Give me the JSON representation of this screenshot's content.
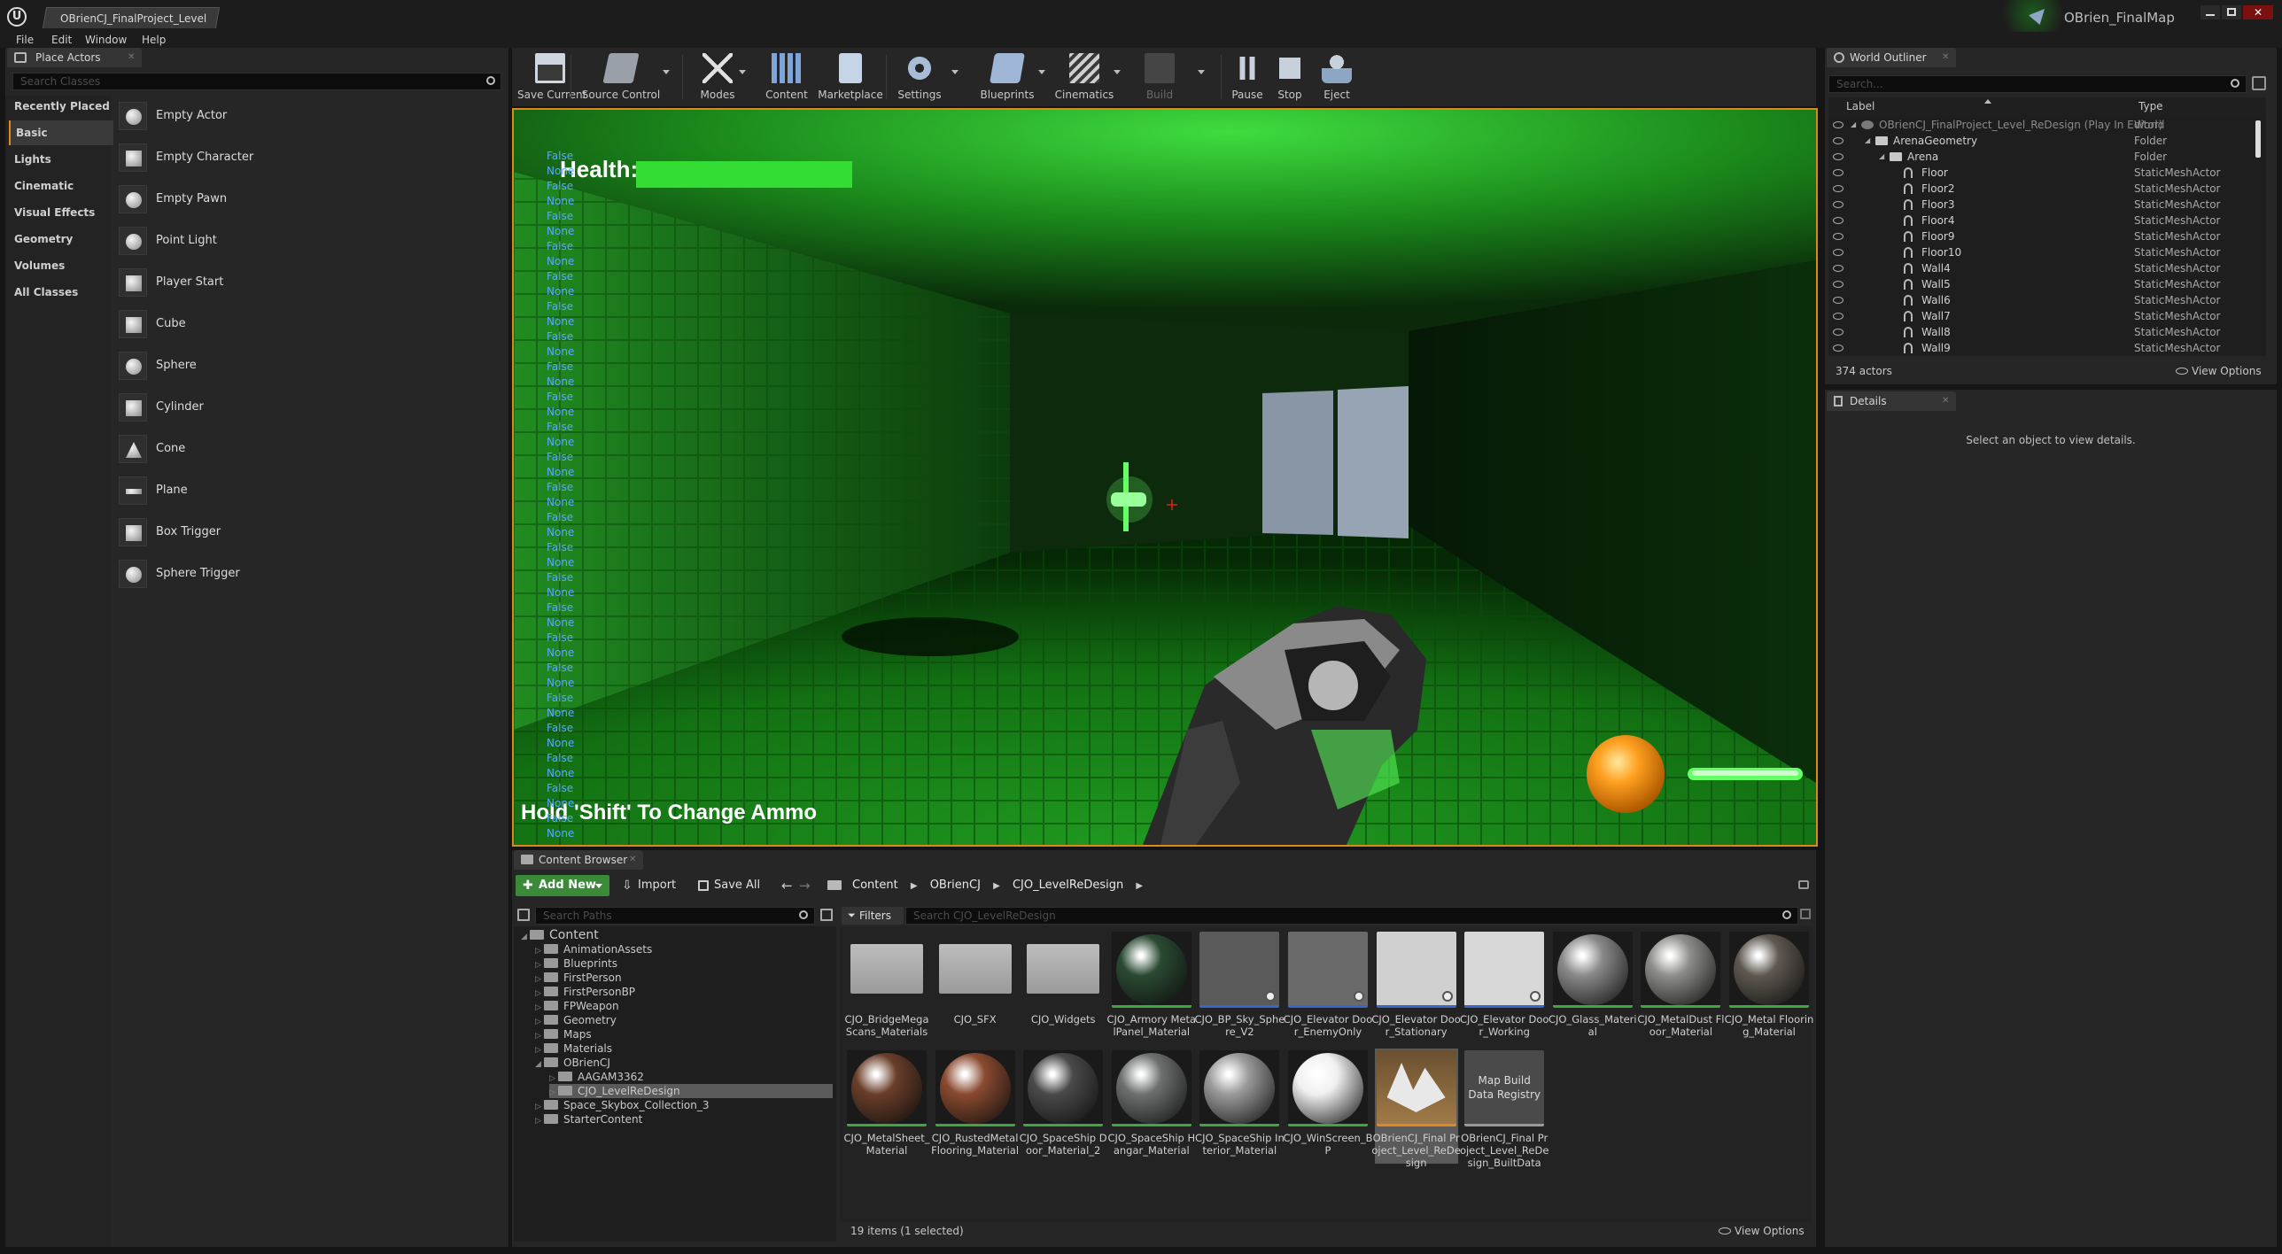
{
  "title_bar": {
    "doc_tab": "OBrienCJ_FinalProject_Level",
    "project_name": "OBrien_FinalMap",
    "window_controls": [
      "minimize",
      "maximize",
      "close"
    ]
  },
  "menu": [
    "File",
    "Edit",
    "Window",
    "Help"
  ],
  "place_actors": {
    "tab_label": "Place Actors",
    "search_placeholder": "Search Classes",
    "categories": [
      "Recently Placed",
      "Basic",
      "Lights",
      "Cinematic",
      "Visual Effects",
      "Geometry",
      "Volumes",
      "All Classes"
    ],
    "selected_category": "Basic",
    "items": [
      "Empty Actor",
      "Empty Character",
      "Empty Pawn",
      "Point Light",
      "Player Start",
      "Cube",
      "Sphere",
      "Cylinder",
      "Cone",
      "Plane",
      "Box Trigger",
      "Sphere Trigger"
    ]
  },
  "toolbar": {
    "buttons": [
      {
        "label": "Save Current",
        "icon": "save-icon"
      },
      {
        "label": "Source Control",
        "icon": "source-control-icon"
      },
      {
        "label": "Modes",
        "icon": "modes-icon"
      },
      {
        "label": "Content",
        "icon": "content-icon"
      },
      {
        "label": "Marketplace",
        "icon": "marketplace-icon"
      },
      {
        "label": "Settings",
        "icon": "settings-icon"
      },
      {
        "label": "Blueprints",
        "icon": "blueprints-icon"
      },
      {
        "label": "Cinematics",
        "icon": "cinematics-icon"
      },
      {
        "label": "Build",
        "icon": "build-icon"
      },
      {
        "label": "Pause",
        "icon": "pause-icon"
      },
      {
        "label": "Stop",
        "icon": "stop-icon"
      },
      {
        "label": "Eject",
        "icon": "eject-icon"
      }
    ]
  },
  "viewport": {
    "hud_health_label": "Health:",
    "hud_health_fraction": 1.0,
    "hud_ammo_text": "Hold 'Shift' To Change Ammo",
    "debug_lines": [
      "False",
      "None",
      "False",
      "None",
      "False",
      "None",
      "False",
      "None",
      "False",
      "None",
      "False",
      "None",
      "False",
      "None",
      "False",
      "None",
      "False",
      "None",
      "False",
      "None",
      "False",
      "None",
      "False",
      "None",
      "False",
      "None",
      "False",
      "None",
      "False",
      "None",
      "False",
      "None",
      "False",
      "None",
      "False",
      "None",
      "False",
      "None"
    ],
    "debug_lines_2": [
      "False",
      "None",
      "False",
      "None",
      "False",
      "None",
      "False",
      "None"
    ],
    "colors": {
      "hud_green": "#33dd33",
      "scene_green": "#1f8a1f",
      "ammo_orb": "#ffa020"
    }
  },
  "world_outliner": {
    "tab_label": "World Outliner",
    "search_placeholder": "Search...",
    "col_label": "Label",
    "col_type": "Type",
    "rows": [
      {
        "name": "OBrienCJ_FinalProject_Level_ReDesign (Play In Editor)",
        "type": "World",
        "depth": 0,
        "kind": "world"
      },
      {
        "name": "ArenaGeometry",
        "type": "Folder",
        "depth": 1,
        "kind": "folder"
      },
      {
        "name": "Arena",
        "type": "Folder",
        "depth": 2,
        "kind": "folder"
      },
      {
        "name": "Floor",
        "type": "StaticMeshActor",
        "depth": 3,
        "kind": "mesh"
      },
      {
        "name": "Floor2",
        "type": "StaticMeshActor",
        "depth": 3,
        "kind": "mesh"
      },
      {
        "name": "Floor3",
        "type": "StaticMeshActor",
        "depth": 3,
        "kind": "mesh"
      },
      {
        "name": "Floor4",
        "type": "StaticMeshActor",
        "depth": 3,
        "kind": "mesh"
      },
      {
        "name": "Floor9",
        "type": "StaticMeshActor",
        "depth": 3,
        "kind": "mesh"
      },
      {
        "name": "Floor10",
        "type": "StaticMeshActor",
        "depth": 3,
        "kind": "mesh"
      },
      {
        "name": "Wall4",
        "type": "StaticMeshActor",
        "depth": 3,
        "kind": "mesh"
      },
      {
        "name": "Wall5",
        "type": "StaticMeshActor",
        "depth": 3,
        "kind": "mesh"
      },
      {
        "name": "Wall6",
        "type": "StaticMeshActor",
        "depth": 3,
        "kind": "mesh"
      },
      {
        "name": "Wall7",
        "type": "StaticMeshActor",
        "depth": 3,
        "kind": "mesh"
      },
      {
        "name": "Wall8",
        "type": "StaticMeshActor",
        "depth": 3,
        "kind": "mesh"
      },
      {
        "name": "Wall9",
        "type": "StaticMeshActor",
        "depth": 3,
        "kind": "mesh"
      }
    ],
    "actor_count": "374 actors",
    "view_options": "View Options"
  },
  "details": {
    "tab_label": "Details",
    "empty_text": "Select an object to view details."
  },
  "content_browser": {
    "tab_label": "Content Browser",
    "add_new": "Add New",
    "import": "Import",
    "save_all": "Save All",
    "breadcrumb": [
      "Content",
      "OBrienCJ",
      "CJO_LevelReDesign"
    ],
    "search_paths_placeholder": "Search Paths",
    "filters": "Filters",
    "search_assets_placeholder": "Search CJO_LevelReDesign",
    "tree": [
      {
        "name": "Content",
        "depth": 0,
        "expanded": true
      },
      {
        "name": "AnimationAssets",
        "depth": 1,
        "expanded": false
      },
      {
        "name": "Blueprints",
        "depth": 1,
        "expanded": false
      },
      {
        "name": "FirstPerson",
        "depth": 1,
        "expanded": false
      },
      {
        "name": "FirstPersonBP",
        "depth": 1,
        "expanded": false
      },
      {
        "name": "FPWeapon",
        "depth": 1,
        "expanded": false
      },
      {
        "name": "Geometry",
        "depth": 1,
        "expanded": false
      },
      {
        "name": "Maps",
        "depth": 1,
        "expanded": false
      },
      {
        "name": "Materials",
        "depth": 1,
        "expanded": false
      },
      {
        "name": "OBrienCJ",
        "depth": 1,
        "expanded": true
      },
      {
        "name": "AAGAM3362",
        "depth": 2,
        "expanded": false
      },
      {
        "name": "CJO_LevelReDesign",
        "depth": 2,
        "expanded": false,
        "selected": true
      },
      {
        "name": "Space_Skybox_Collection_3",
        "depth": 1,
        "expanded": false
      },
      {
        "name": "StarterContent",
        "depth": 1,
        "expanded": false
      }
    ],
    "assets": [
      {
        "label": "CJO_BridgeMegaScans_Materials",
        "kind": "folder"
      },
      {
        "label": "CJO_SFX",
        "kind": "folder"
      },
      {
        "label": "CJO_Widgets",
        "kind": "folder"
      },
      {
        "label": "CJO_Armory MetalPanel_Material",
        "kind": "sphere",
        "color": "#2a4a32"
      },
      {
        "label": "CJO_BP_Sky_Sphere_V2",
        "kind": "flat",
        "color": "#5a5a5a"
      },
      {
        "label": "CJO_Elevator Door_EnemyOnly",
        "kind": "panel",
        "color": "#6a6a6a"
      },
      {
        "label": "CJO_Elevator Door_Stationary",
        "kind": "panel",
        "color": "#d0d0d0"
      },
      {
        "label": "CJO_Elevator Door_Working",
        "kind": "panel",
        "color": "#d8d8d8"
      },
      {
        "label": "CJO_Glass_Material",
        "kind": "sphere",
        "color": "#8a8a8a"
      },
      {
        "label": "CJO_MetalDust Floor_Material",
        "kind": "sphere",
        "color": "#8e8e8c"
      },
      {
        "label": "CJO_Metal Flooring_Material",
        "kind": "sphere",
        "color": "#5e5850"
      },
      {
        "label": "CJO_MetalSheet_Material",
        "kind": "sphere",
        "color": "#6a3e2a"
      },
      {
        "label": "CJO_RustedMetal Flooring_Material",
        "kind": "sphere",
        "color": "#8a4a30"
      },
      {
        "label": "CJO_SpaceShip Door_Material_2",
        "kind": "sphere",
        "color": "#4a4a4a"
      },
      {
        "label": "CJO_SpaceShip Hangar_Material",
        "kind": "sphere",
        "color": "#6e7070"
      },
      {
        "label": "CJO_SpaceShip Interior_Material",
        "kind": "sphere",
        "color": "#9a9a9a"
      },
      {
        "label": "CJO_WinScreen_BP",
        "kind": "sphere",
        "color": "#f0f0f0"
      },
      {
        "label": "OBrienCJ_Final Project_Level_ReDesign",
        "kind": "level",
        "color": "#8a6a40"
      },
      {
        "label": "OBrienCJ_Final Project_Level_ReDesign_BuiltData",
        "kind": "text",
        "thumb_text": "Map Build Data Registry"
      }
    ],
    "status": "19 items (1 selected)",
    "view_options": "View Options"
  }
}
